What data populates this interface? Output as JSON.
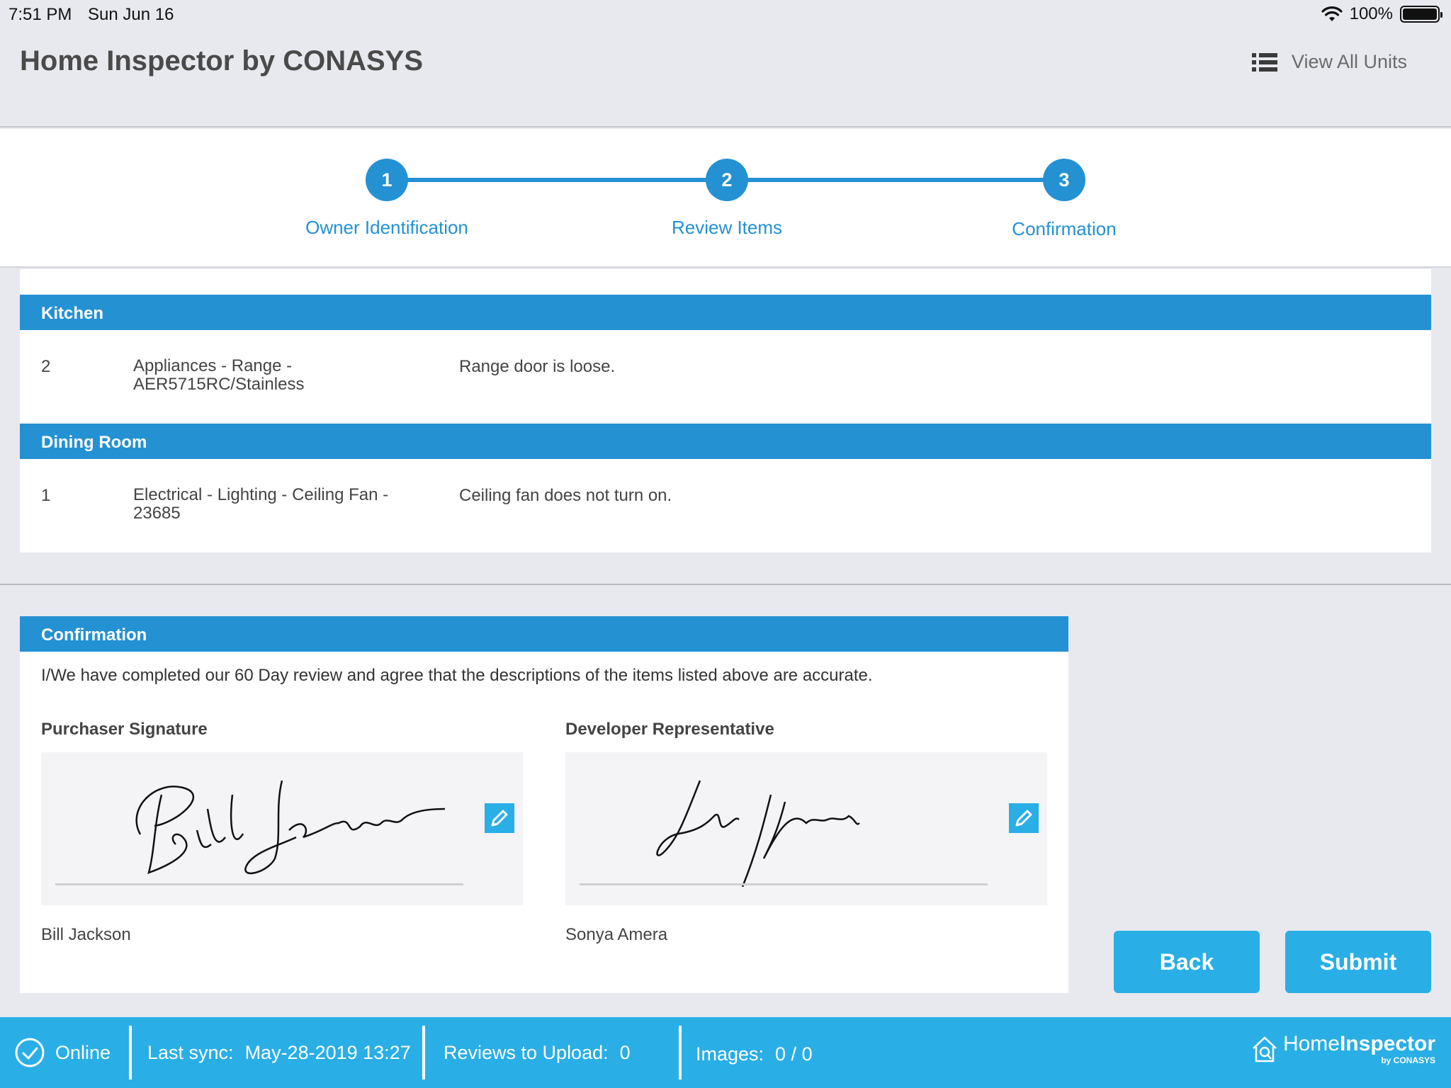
{
  "status_bar": {
    "time": "7:51 PM",
    "date": "Sun Jun 16",
    "battery": "100%"
  },
  "header": {
    "title": "Home Inspector by CONASYS",
    "view_all_label": "View All Units"
  },
  "stepper": {
    "steps": [
      {
        "number": "1",
        "label": "Owner Identification"
      },
      {
        "number": "2",
        "label": "Review Items"
      },
      {
        "number": "3",
        "label": "Confirmation"
      }
    ]
  },
  "review": {
    "sections": [
      {
        "name": "Kitchen",
        "items": [
          {
            "number": "2",
            "description": "Appliances - Range - AER5715RC/Stainless",
            "note": "Range door is loose."
          }
        ]
      },
      {
        "name": "Dining Room",
        "items": [
          {
            "number": "1",
            "description": "Electrical - Lighting - Ceiling Fan - 23685",
            "note": "Ceiling fan does not turn on."
          }
        ]
      }
    ]
  },
  "confirmation": {
    "title": "Confirmation",
    "statement": "I/We have completed our 60 Day review and agree that the descriptions of the items listed above are accurate.",
    "purchaser": {
      "label": "Purchaser Signature",
      "name": "Bill Jackson"
    },
    "developer": {
      "label": "Developer Representative",
      "name": "Sonya Amera"
    }
  },
  "buttons": {
    "back": "Back",
    "submit": "Submit"
  },
  "footer": {
    "status": "Online",
    "last_sync_label": "Last sync:",
    "last_sync_value": "May-28-2019 13:27",
    "reviews_label": "Reviews to Upload:",
    "reviews_value": "0",
    "images_label": "Images:",
    "images_value": "0 / 0",
    "brand_home": "Home",
    "brand_inspector": "Inspector",
    "brand_by": "by CONASYS"
  },
  "colors": {
    "primary": "#2491d3",
    "accent": "#29aee6",
    "background": "#e8e9ee"
  }
}
